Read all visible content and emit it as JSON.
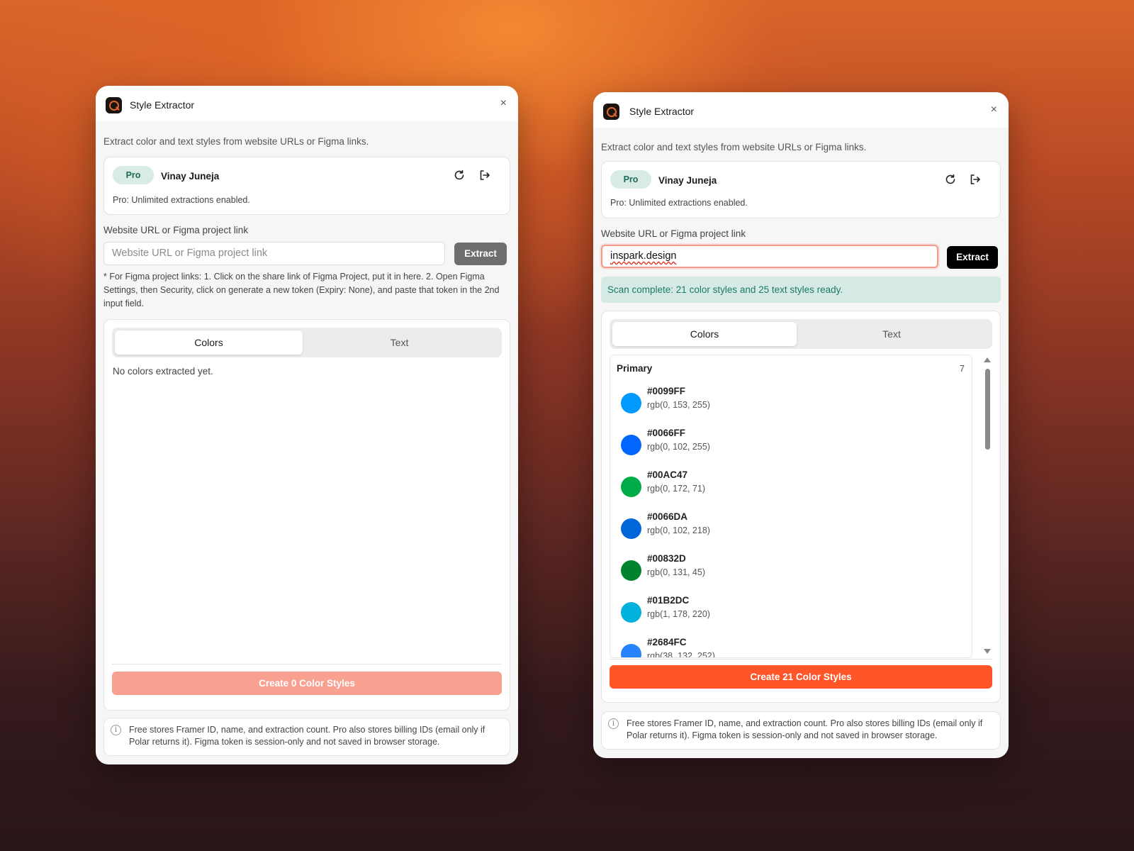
{
  "panel_left": {
    "app_title": "Style Extractor",
    "close_glyph": "×",
    "description": "Extract color and text styles from website URLs or Figma links.",
    "account": {
      "plan_badge": "Pro",
      "user_name": "Vinay Juneja",
      "plan_note": "Pro: Unlimited extractions enabled."
    },
    "url_label": "Website URL or Figma project link",
    "url_placeholder": "Website URL or Figma project link",
    "extract_button": "Extract",
    "figma_note": "* For Figma project links: 1. Click on the share link of Figma Project, put it in here. 2. Open Figma Settings, then Security, click on generate a new token (Expiry: None), and paste that token in the 2nd input field.",
    "tabs": {
      "colors": "Colors",
      "text": "Text"
    },
    "empty_message": "No colors extracted yet.",
    "create_button": "Create 0 Color Styles",
    "footer_note": "Free stores Framer ID, name, and extraction count. Pro also stores billing IDs (email only if Polar returns it). Figma token is session-only and not saved in browser storage."
  },
  "panel_right": {
    "app_title": "Style Extractor",
    "close_glyph": "×",
    "description": "Extract color and text styles from website URLs or Figma links.",
    "account": {
      "plan_badge": "Pro",
      "user_name": "Vinay Juneja",
      "plan_note": "Pro: Unlimited extractions enabled."
    },
    "url_label": "Website URL or Figma project link",
    "url_value": "inspark.design",
    "extract_button": "Extract",
    "status_message": "Scan complete: 21 color styles and 25 text styles ready.",
    "tabs": {
      "colors": "Colors",
      "text": "Text"
    },
    "group": {
      "name": "Primary",
      "count": "7"
    },
    "colors": [
      {
        "hex": "#0099FF",
        "rgb": "rgb(0, 153, 255)",
        "swatch": "#0099FF"
      },
      {
        "hex": "#0066FF",
        "rgb": "rgb(0, 102, 255)",
        "swatch": "#0066FF"
      },
      {
        "hex": "#00AC47",
        "rgb": "rgb(0, 172, 71)",
        "swatch": "#00AC47"
      },
      {
        "hex": "#0066DA",
        "rgb": "rgb(0, 102, 218)",
        "swatch": "#0066DA"
      },
      {
        "hex": "#00832D",
        "rgb": "rgb(0, 131, 45)",
        "swatch": "#00832D"
      },
      {
        "hex": "#01B2DC",
        "rgb": "rgb(1, 178, 220)",
        "swatch": "#01B2DC"
      },
      {
        "hex": "#2684FC",
        "rgb": "rgb(38, 132, 252)",
        "swatch": "#2684FC"
      }
    ],
    "create_button": "Create 21 Color Styles",
    "footer_note": "Free stores Framer ID, name, and extraction count. Pro also stores billing IDs (email only if Polar returns it). Figma token is session-only and not saved in browser storage."
  },
  "colors_ui": {
    "accent": "#FF5529",
    "accent_disabled": "#F9A190",
    "extract_disabled": "#6E6E6E",
    "extract_enabled": "#000000",
    "pro_badge_bg": "#D8EBE5",
    "success_bg": "#D5E9E5"
  },
  "icons": [
    "app-logo-icon",
    "close-icon",
    "refresh-icon",
    "logout-icon",
    "info-icon"
  ]
}
